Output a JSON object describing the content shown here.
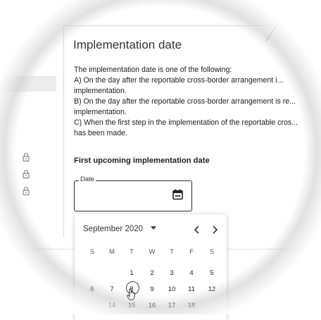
{
  "title": "Implementation date",
  "description_lines": [
    "The implementation date is one of the following:",
    "A) On the day after the reportable cross-border arrangement i...",
    "implementation.",
    "B) On the day after the reportable cross-border arrangement is re...",
    "implementation.",
    "C) When the first step in the implementation of the reportable cros...",
    "has been made."
  ],
  "field_heading": "First upcoming implementation date",
  "date_field": {
    "label": "Date",
    "value": ""
  },
  "calendar": {
    "month_label": "September 2020",
    "weekdays": [
      "S",
      "M",
      "T",
      "W",
      "T",
      "F",
      "S"
    ],
    "week1": [
      "1",
      "2",
      "3",
      "4",
      "5"
    ],
    "week2": [
      "6",
      "7",
      "8",
      "9",
      "10",
      "11",
      "12"
    ],
    "week3": [
      "14",
      "15",
      "16",
      "17",
      "18"
    ],
    "selected_day": "8"
  },
  "icons": [
    "lock-icon",
    "calendar-icon",
    "dropdown-arrow-icon",
    "chevron-left-icon",
    "chevron-right-icon",
    "hand-pointer-icon"
  ]
}
